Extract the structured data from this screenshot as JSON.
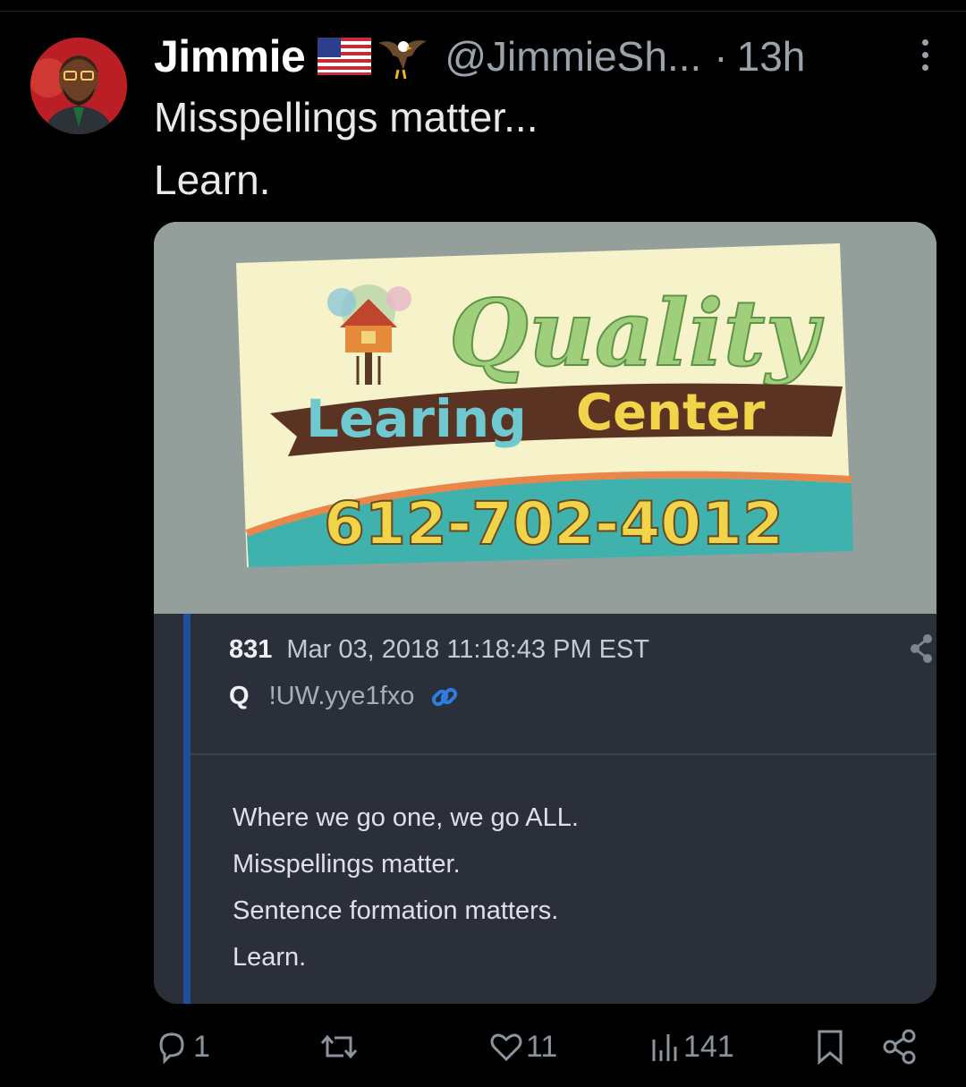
{
  "tweet": {
    "author_name": "Jimmie",
    "flag_emoji": "🇺🇸",
    "eagle_emoji": "🦅",
    "handle": "@JimmieSh...",
    "separator": "·",
    "time": "13h",
    "text_lines": [
      "Misspellings matter...",
      "Learn."
    ]
  },
  "media": {
    "sign": {
      "word1": "Quality",
      "word2": "Learing",
      "word3": "Center",
      "phone": "612-702-4012"
    },
    "q_post": {
      "number": "831",
      "timestamp": "Mar 03, 2018 11:18:43 PM EST",
      "name": "Q",
      "tripcode": "!UW.yye1fxo",
      "lines": [
        "Where we go one, we go ALL.",
        "Misspellings matter.",
        "Sentence formation matters.",
        "Learn."
      ]
    }
  },
  "actions": {
    "reply_count": "1",
    "retweet_count": "",
    "like_count": "11",
    "view_count": "141"
  },
  "colors": {
    "background": "#000000",
    "text": "#e7e9ea",
    "secondary_text": "#9aa3ab",
    "q_post_bg": "#2a2f3a",
    "q_bar": "#1f4f9a"
  }
}
